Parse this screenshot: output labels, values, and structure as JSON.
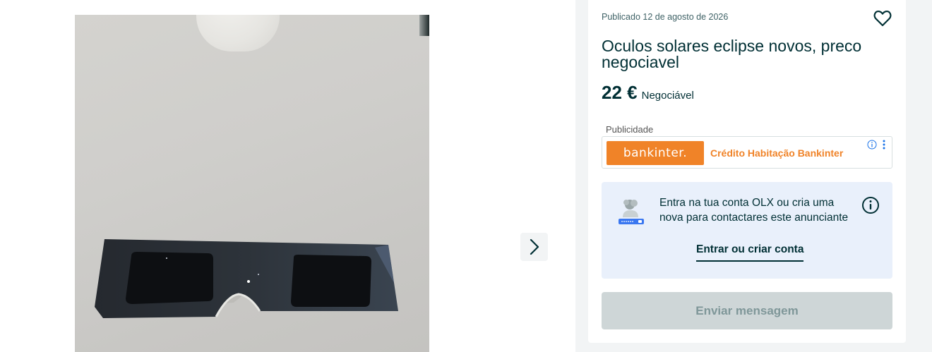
{
  "listing": {
    "published": "Publicado 12 de agosto de 2026",
    "title": "Oculos solares eclipse novos, preco negociavel",
    "price": "22 €",
    "negotiable": "Negociável"
  },
  "gallery": {
    "next_icon": "chevron-right-icon"
  },
  "ad": {
    "label": "Publicidade",
    "brand": "bankinter.",
    "text": "Crédito Habitação Bankinter",
    "brand_color": "#f08328"
  },
  "login": {
    "message": "Entra na tua conta OLX ou cria uma nova para contactares este anunciante",
    "link": "Entrar ou criar conta",
    "background": "#e9f0fb"
  },
  "actions": {
    "send_message": "Enviar mensagem",
    "favorite_icon": "heart-icon"
  },
  "colors": {
    "text_primary": "#002f34",
    "panel_bg": "#f2f4f5"
  }
}
